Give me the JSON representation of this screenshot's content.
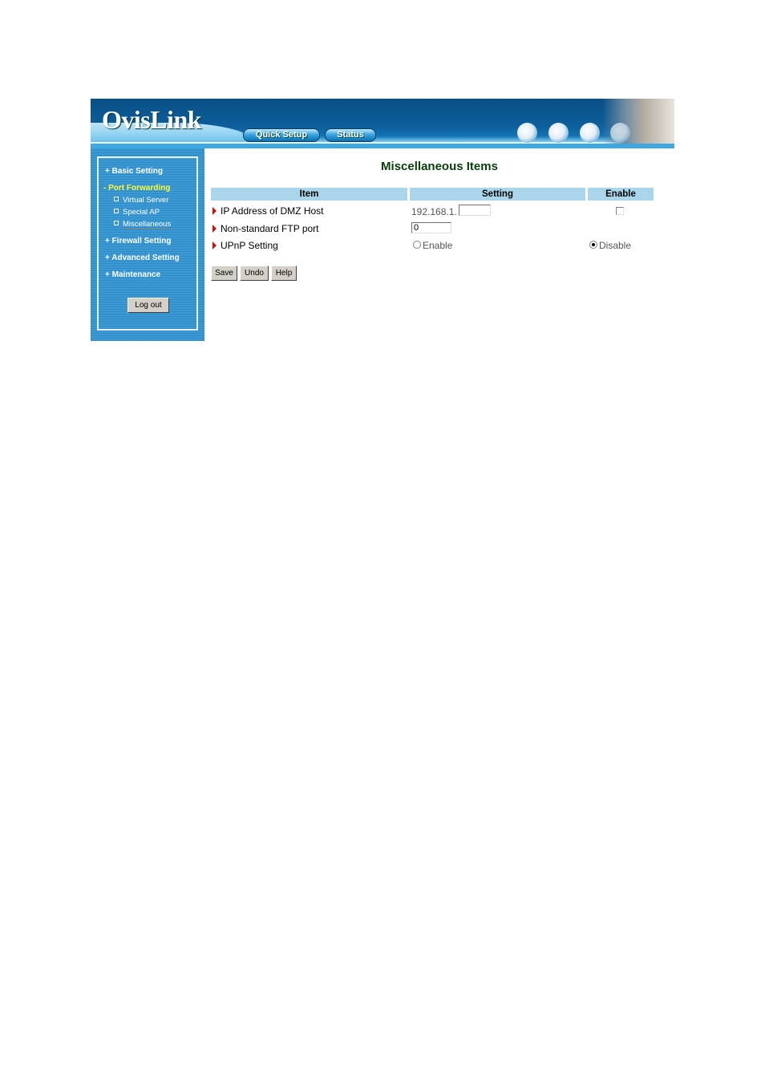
{
  "header": {
    "logo": "OvisLink",
    "nav": [
      {
        "label": "Quick Setup"
      },
      {
        "label": "Status"
      }
    ]
  },
  "sidebar": {
    "menu": [
      {
        "label": "+ Basic Setting",
        "active": false
      },
      {
        "label": "- Port Forwarding",
        "active": true
      },
      {
        "label": "+ Firewall Setting",
        "active": false
      },
      {
        "label": "+ Advanced Setting",
        "active": false
      },
      {
        "label": "+ Maintenance",
        "active": false
      }
    ],
    "submenu": [
      {
        "label": "Virtual Server"
      },
      {
        "label": "Special AP"
      },
      {
        "label": "Miscellaneous",
        "current": true
      }
    ],
    "logout_label": "Log out"
  },
  "main": {
    "title": "Miscellaneous Items",
    "columns": [
      "Item",
      "Setting",
      "Enable"
    ],
    "rows": [
      {
        "item": "IP Address of DMZ Host",
        "setting_prefix": "192.168.1.",
        "setting_value": "",
        "enable_checked": false
      },
      {
        "item": "Non-standard FTP port",
        "setting_value": "0"
      },
      {
        "item": "UPnP Setting",
        "options": [
          "Enable",
          "Disable"
        ],
        "selected": "Disable"
      }
    ],
    "buttons": {
      "save": "Save",
      "undo": "Undo",
      "help": "Help"
    }
  },
  "colors": {
    "header_blue": "#0c5e9a",
    "sidebar_blue": "#3b9ad4",
    "table_header": "#a9d6ea",
    "title_green": "#0b3d0b",
    "active_menu": "#ffff33"
  }
}
